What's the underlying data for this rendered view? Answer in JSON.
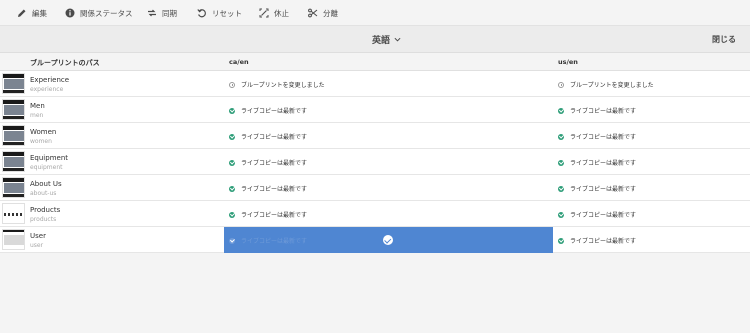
{
  "toolbar": {
    "items": [
      {
        "label": "編集",
        "icon": "pencil-icon"
      },
      {
        "label": "関係ステータス",
        "icon": "info-icon"
      },
      {
        "label": "同期",
        "icon": "sync-icon"
      },
      {
        "label": "リセット",
        "icon": "reset-icon"
      },
      {
        "label": "休止",
        "icon": "suspend-icon"
      },
      {
        "label": "分離",
        "icon": "detach-icon"
      }
    ]
  },
  "langbar": {
    "language": "英語",
    "close_label": "閉じる"
  },
  "table": {
    "headers": [
      "ブループリントのパス",
      "ca/en",
      "us/en"
    ],
    "rows": [
      {
        "name": "Experience",
        "sub": "experience",
        "c2": "ブループリントを変更しました",
        "c2_icon": "clock",
        "c3": "ブループリントを変更しました",
        "c3_icon": "clock"
      },
      {
        "name": "Men",
        "sub": "men",
        "c2": "ライブコピーは最新です",
        "c2_icon": "ok",
        "c3": "ライブコピーは最新です",
        "c3_icon": "ok"
      },
      {
        "name": "Women",
        "sub": "women",
        "c2": "ライブコピーは最新です",
        "c2_icon": "ok",
        "c3": "ライブコピーは最新です",
        "c3_icon": "ok"
      },
      {
        "name": "Equipment",
        "sub": "equipment",
        "c2": "ライブコピーは最新です",
        "c2_icon": "ok",
        "c3": "ライブコピーは最新です",
        "c3_icon": "ok"
      },
      {
        "name": "About Us",
        "sub": "about-us",
        "c2": "ライブコピーは最新です",
        "c2_icon": "ok",
        "c3": "ライブコピーは最新です",
        "c3_icon": "ok"
      },
      {
        "name": "Products",
        "sub": "products",
        "c2": "ライブコピーは最新です",
        "c2_icon": "ok",
        "c3": "ライブコピーは最新です",
        "c3_icon": "ok"
      },
      {
        "name": "User",
        "sub": "user",
        "c2": "ライブコピーは最新です",
        "c2_icon": "ok",
        "c3": "ライブコピーは最新です",
        "c3_icon": "ok"
      }
    ]
  },
  "colors": {
    "selection": "#4f86d2",
    "status_ok": "#2d9d78"
  }
}
